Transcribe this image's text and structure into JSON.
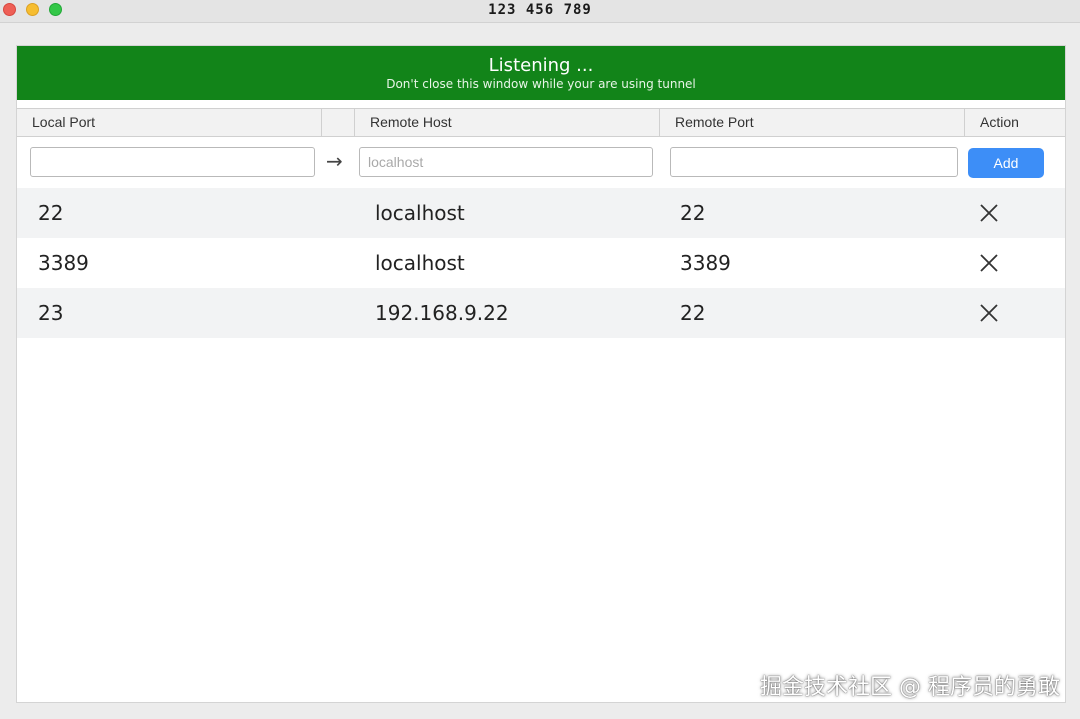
{
  "window": {
    "title": "123 456 789"
  },
  "banner": {
    "title": "Listening ...",
    "subtitle": "Don't close this window while your are using tunnel",
    "color": "#128419"
  },
  "table": {
    "headers": [
      "Local Port",
      "",
      "Remote Host",
      "Remote Port",
      "Action"
    ],
    "input": {
      "local_port": "",
      "arrow": "→",
      "remote_host_placeholder": "localhost",
      "remote_port": "",
      "add_label": "Add"
    },
    "rows": [
      {
        "local_port": "22",
        "remote_host": "localhost",
        "remote_port": "22",
        "action_icon": "close-icon"
      },
      {
        "local_port": "3389",
        "remote_host": "localhost",
        "remote_port": "3389",
        "action_icon": "close-icon"
      },
      {
        "local_port": "23",
        "remote_host": "192.168.9.22",
        "remote_port": "22",
        "action_icon": "close-icon"
      }
    ]
  },
  "watermark": "掘金技术社区 @ 程序员的勇敢",
  "colors": {
    "accent": "#3d8ef7"
  }
}
